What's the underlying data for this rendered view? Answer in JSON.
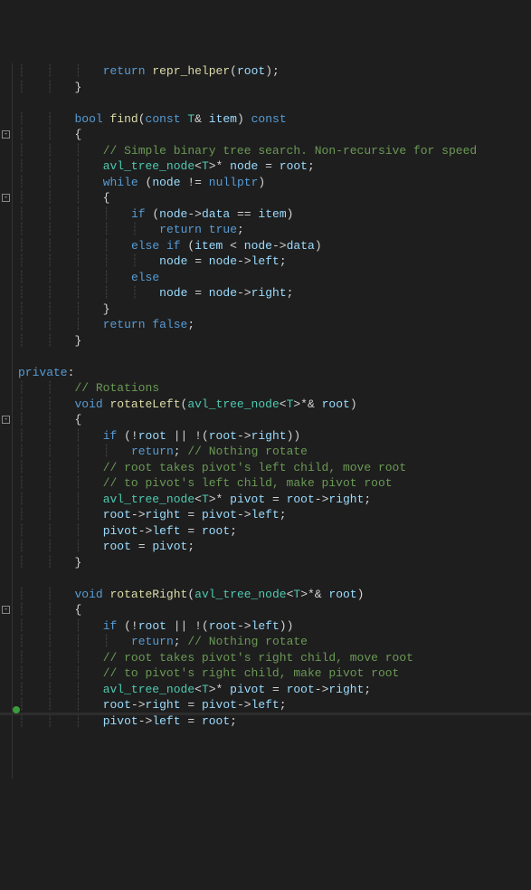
{
  "lines": [
    {
      "i": 3,
      "segs": [
        [
          "kw",
          "return"
        ],
        [
          "op",
          " "
        ],
        [
          "fn",
          "repr_helper"
        ],
        [
          "punct",
          "("
        ],
        [
          "param",
          "root"
        ],
        [
          "punct",
          ");"
        ]
      ]
    },
    {
      "i": 2,
      "segs": [
        [
          "punct",
          "}"
        ]
      ]
    },
    {
      "i": 0,
      "segs": []
    },
    {
      "i": 2,
      "segs": [
        [
          "type",
          "bool"
        ],
        [
          "op",
          " "
        ],
        [
          "fn",
          "find"
        ],
        [
          "punct",
          "("
        ],
        [
          "kw",
          "const"
        ],
        [
          "op",
          " "
        ],
        [
          "cls",
          "T"
        ],
        [
          "punct",
          "& "
        ],
        [
          "param",
          "item"
        ],
        [
          "punct",
          ") "
        ],
        [
          "kw",
          "const"
        ]
      ]
    },
    {
      "i": 2,
      "segs": [
        [
          "punct",
          "{"
        ]
      ]
    },
    {
      "i": 3,
      "segs": [
        [
          "cmt",
          "// Simple binary tree search. Non-recursive for speed"
        ]
      ]
    },
    {
      "i": 3,
      "segs": [
        [
          "cls",
          "avl_tree_node"
        ],
        [
          "punct",
          "<"
        ],
        [
          "cls",
          "T"
        ],
        [
          "punct",
          ">* "
        ],
        [
          "param",
          "node"
        ],
        [
          "op",
          " = "
        ],
        [
          "param",
          "root"
        ],
        [
          "punct",
          ";"
        ]
      ]
    },
    {
      "i": 3,
      "segs": [
        [
          "kw",
          "while"
        ],
        [
          "op",
          " ("
        ],
        [
          "param",
          "node"
        ],
        [
          "op",
          " != "
        ],
        [
          "kw",
          "nullptr"
        ],
        [
          "punct",
          ")"
        ]
      ]
    },
    {
      "i": 3,
      "segs": [
        [
          "punct",
          "{"
        ]
      ]
    },
    {
      "i": 4,
      "segs": [
        [
          "kw",
          "if"
        ],
        [
          "op",
          " ("
        ],
        [
          "param",
          "node"
        ],
        [
          "op",
          "->"
        ],
        [
          "param",
          "data"
        ],
        [
          "op",
          " == "
        ],
        [
          "param",
          "item"
        ],
        [
          "punct",
          ")"
        ]
      ]
    },
    {
      "i": 5,
      "segs": [
        [
          "kw",
          "return"
        ],
        [
          "op",
          " "
        ],
        [
          "kw",
          "true"
        ],
        [
          "punct",
          ";"
        ]
      ]
    },
    {
      "i": 4,
      "segs": [
        [
          "kw",
          "else if"
        ],
        [
          "op",
          " ("
        ],
        [
          "param",
          "item"
        ],
        [
          "op",
          " < "
        ],
        [
          "param",
          "node"
        ],
        [
          "op",
          "->"
        ],
        [
          "param",
          "data"
        ],
        [
          "punct",
          ")"
        ]
      ]
    },
    {
      "i": 5,
      "segs": [
        [
          "param",
          "node"
        ],
        [
          "op",
          " = "
        ],
        [
          "param",
          "node"
        ],
        [
          "op",
          "->"
        ],
        [
          "param",
          "left"
        ],
        [
          "punct",
          ";"
        ]
      ]
    },
    {
      "i": 4,
      "segs": [
        [
          "kw",
          "else"
        ]
      ]
    },
    {
      "i": 5,
      "segs": [
        [
          "param",
          "node"
        ],
        [
          "op",
          " = "
        ],
        [
          "param",
          "node"
        ],
        [
          "op",
          "->"
        ],
        [
          "param",
          "right"
        ],
        [
          "punct",
          ";"
        ]
      ]
    },
    {
      "i": 3,
      "segs": [
        [
          "punct",
          "}"
        ]
      ]
    },
    {
      "i": 3,
      "segs": [
        [
          "kw",
          "return"
        ],
        [
          "op",
          " "
        ],
        [
          "kw",
          "false"
        ],
        [
          "punct",
          ";"
        ]
      ]
    },
    {
      "i": 2,
      "segs": [
        [
          "punct",
          "}"
        ]
      ]
    },
    {
      "i": 0,
      "segs": []
    },
    {
      "i": 0,
      "segs": [
        [
          "priv",
          "private"
        ],
        [
          "punct",
          ":"
        ]
      ]
    },
    {
      "i": 2,
      "segs": [
        [
          "cmt",
          "// Rotations"
        ]
      ]
    },
    {
      "i": 2,
      "segs": [
        [
          "type",
          "void"
        ],
        [
          "op",
          " "
        ],
        [
          "fn",
          "rotateLeft"
        ],
        [
          "punct",
          "("
        ],
        [
          "cls",
          "avl_tree_node"
        ],
        [
          "punct",
          "<"
        ],
        [
          "cls",
          "T"
        ],
        [
          "punct",
          ">*& "
        ],
        [
          "param",
          "root"
        ],
        [
          "punct",
          ")"
        ]
      ]
    },
    {
      "i": 2,
      "segs": [
        [
          "punct",
          "{"
        ]
      ]
    },
    {
      "i": 3,
      "segs": [
        [
          "kw",
          "if"
        ],
        [
          "op",
          " (!"
        ],
        [
          "param",
          "root"
        ],
        [
          "op",
          " || !("
        ],
        [
          "param",
          "root"
        ],
        [
          "op",
          "->"
        ],
        [
          "param",
          "right"
        ],
        [
          "punct",
          "))"
        ]
      ]
    },
    {
      "i": 4,
      "segs": [
        [
          "kw",
          "return"
        ],
        [
          "punct",
          "; "
        ],
        [
          "cmt",
          "// Nothing rotate"
        ]
      ]
    },
    {
      "i": 3,
      "segs": [
        [
          "cmt",
          "// root takes pivot's left child, move root"
        ]
      ]
    },
    {
      "i": 3,
      "segs": [
        [
          "cmt",
          "// to pivot's left child, make pivot root"
        ]
      ]
    },
    {
      "i": 3,
      "segs": [
        [
          "cls",
          "avl_tree_node"
        ],
        [
          "punct",
          "<"
        ],
        [
          "cls",
          "T"
        ],
        [
          "punct",
          ">* "
        ],
        [
          "param",
          "pivot"
        ],
        [
          "op",
          " = "
        ],
        [
          "param",
          "root"
        ],
        [
          "op",
          "->"
        ],
        [
          "param",
          "right"
        ],
        [
          "punct",
          ";"
        ]
      ]
    },
    {
      "i": 3,
      "segs": [
        [
          "param",
          "root"
        ],
        [
          "op",
          "->"
        ],
        [
          "param",
          "right"
        ],
        [
          "op",
          " = "
        ],
        [
          "param",
          "pivot"
        ],
        [
          "op",
          "->"
        ],
        [
          "param",
          "left"
        ],
        [
          "punct",
          ";"
        ]
      ]
    },
    {
      "i": 3,
      "segs": [
        [
          "param",
          "pivot"
        ],
        [
          "op",
          "->"
        ],
        [
          "param",
          "left"
        ],
        [
          "op",
          " = "
        ],
        [
          "param",
          "root"
        ],
        [
          "punct",
          ";"
        ]
      ]
    },
    {
      "i": 3,
      "segs": [
        [
          "param",
          "root"
        ],
        [
          "op",
          " = "
        ],
        [
          "param",
          "pivot"
        ],
        [
          "punct",
          ";"
        ]
      ]
    },
    {
      "i": 2,
      "segs": [
        [
          "punct",
          "}"
        ]
      ]
    },
    {
      "i": 0,
      "segs": []
    },
    {
      "i": 2,
      "segs": [
        [
          "type",
          "void"
        ],
        [
          "op",
          " "
        ],
        [
          "fn",
          "rotateRight"
        ],
        [
          "punct",
          "("
        ],
        [
          "cls",
          "avl_tree_node"
        ],
        [
          "punct",
          "<"
        ],
        [
          "cls",
          "T"
        ],
        [
          "punct",
          ">*& "
        ],
        [
          "param",
          "root"
        ],
        [
          "punct",
          ")"
        ]
      ]
    },
    {
      "i": 2,
      "segs": [
        [
          "punct",
          "{"
        ]
      ]
    },
    {
      "i": 3,
      "segs": [
        [
          "kw",
          "if"
        ],
        [
          "op",
          " (!"
        ],
        [
          "param",
          "root"
        ],
        [
          "op",
          " || !("
        ],
        [
          "param",
          "root"
        ],
        [
          "op",
          "->"
        ],
        [
          "param",
          "left"
        ],
        [
          "punct",
          "))"
        ]
      ]
    },
    {
      "i": 4,
      "segs": [
        [
          "kw",
          "return"
        ],
        [
          "punct",
          "; "
        ],
        [
          "cmt",
          "// Nothing rotate"
        ]
      ]
    },
    {
      "i": 3,
      "segs": [
        [
          "cmt",
          "// root takes pivot's right child, move root"
        ]
      ]
    },
    {
      "i": 3,
      "segs": [
        [
          "cmt",
          "// to pivot's right child, make pivot root"
        ]
      ]
    },
    {
      "i": 3,
      "segs": [
        [
          "cls",
          "avl_tree_node"
        ],
        [
          "punct",
          "<"
        ],
        [
          "cls",
          "T"
        ],
        [
          "punct",
          ">* "
        ],
        [
          "param",
          "pivot"
        ],
        [
          "op",
          " = "
        ],
        [
          "param",
          "root"
        ],
        [
          "op",
          "->"
        ],
        [
          "param",
          "right"
        ],
        [
          "punct",
          ";"
        ]
      ]
    },
    {
      "i": 3,
      "segs": [
        [
          "param",
          "root"
        ],
        [
          "op",
          "->"
        ],
        [
          "param",
          "right"
        ],
        [
          "op",
          " = "
        ],
        [
          "param",
          "pivot"
        ],
        [
          "op",
          "->"
        ],
        [
          "param",
          "left"
        ],
        [
          "punct",
          ";"
        ]
      ]
    },
    {
      "i": 3,
      "segs": [
        [
          "param",
          "pivot"
        ],
        [
          "op",
          "->"
        ],
        [
          "param",
          "left"
        ],
        [
          "op",
          " = "
        ],
        [
          "param",
          "root"
        ],
        [
          "punct",
          ";"
        ]
      ]
    }
  ],
  "fold_markers": [
    4,
    8,
    22,
    34
  ],
  "indent_unit": "    ",
  "guide_char": "┊   "
}
